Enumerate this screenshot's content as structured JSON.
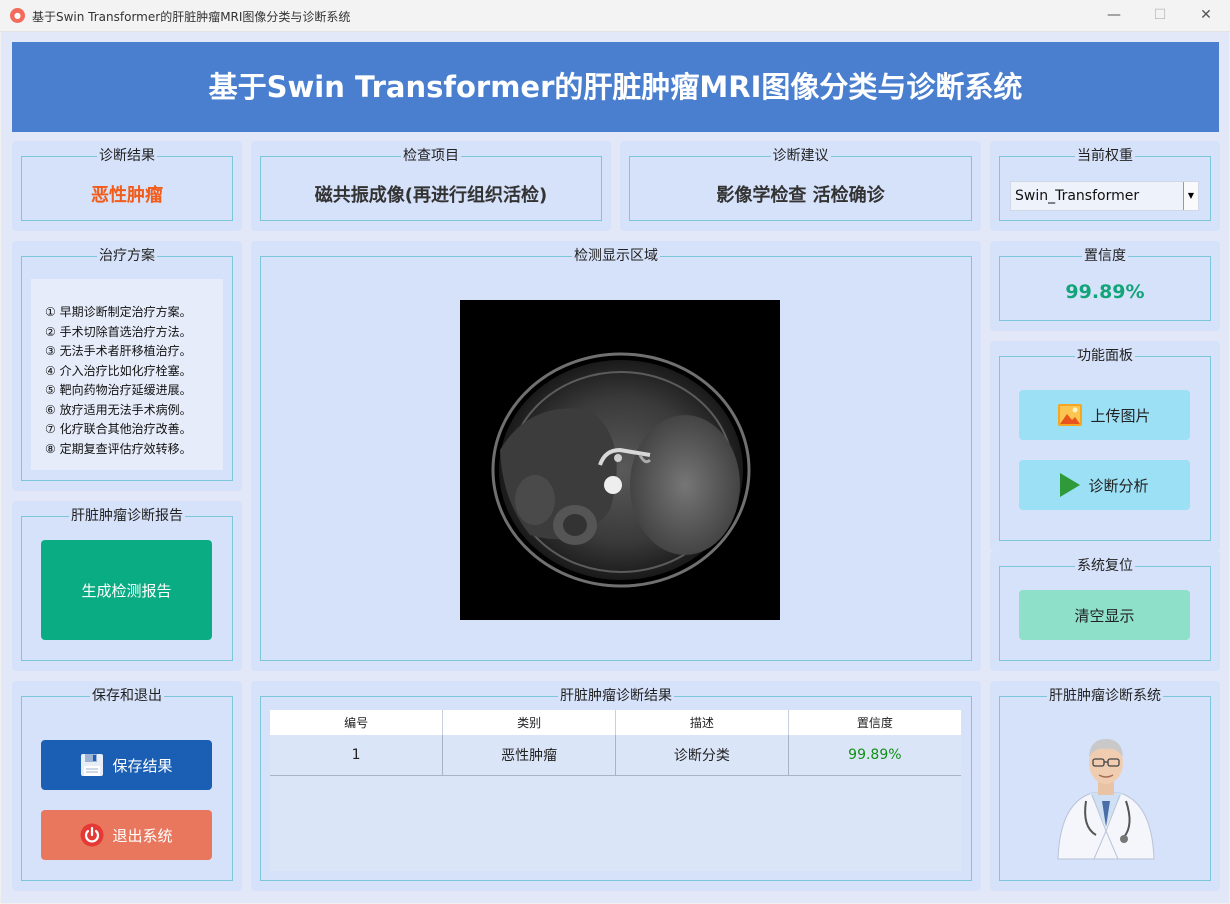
{
  "window": {
    "title": "基于Swin Transformer的肝脏肿瘤MRI图像分类与诊断系统",
    "icon_name": "app-logo-icon",
    "controls": [
      "minimize-icon",
      "maximize-icon",
      "close-icon"
    ]
  },
  "header": {
    "title": "基于Swin Transformer的肝脏肿瘤MRI图像分类与诊断系统"
  },
  "diagnosis_result": {
    "label": "诊断结果",
    "value": "恶性肿瘤",
    "color": "#f25c1a"
  },
  "exam_item": {
    "label": "检查项目",
    "value": "磁共振成像(再进行组织活检)"
  },
  "diagnosis_advice": {
    "label": "诊断建议",
    "value": "影像学检查 活检确诊"
  },
  "weights": {
    "label": "当前权重",
    "selected": "Swin_Transformer"
  },
  "treatment": {
    "label": "治疗方案",
    "items": [
      "① 早期诊断制定治疗方案。",
      "② 手术切除首选治疗方法。",
      "③ 无法手术者肝移植治疗。",
      "④ 介入治疗比如化疗栓塞。",
      "⑤ 靶向药物治疗延缓进展。",
      "⑥ 放疗适用无法手术病例。",
      "⑦ 化疗联合其他治疗改善。",
      "⑧ 定期复查评估疗效转移。"
    ]
  },
  "detection_area": {
    "label": "检测显示区域"
  },
  "confidence": {
    "label": "置信度",
    "value": "99.89%",
    "color": "#13a57a"
  },
  "function_panel": {
    "label": "功能面板",
    "upload_label": "上传图片",
    "upload_icon": "image-icon",
    "analyze_label": "诊断分析",
    "analyze_icon": "play-icon"
  },
  "report": {
    "label": "肝脏肿瘤诊断报告",
    "button_label": "生成检测报告"
  },
  "reset": {
    "label": "系统复位",
    "button_label": "清空显示"
  },
  "save_exit": {
    "label": "保存和退出",
    "save_label": "保存结果",
    "save_icon": "floppy-disk-icon",
    "exit_label": "退出系统",
    "exit_icon": "power-icon"
  },
  "results_table": {
    "label": "肝脏肿瘤诊断结果",
    "columns": [
      "编号",
      "类别",
      "描述",
      "置信度"
    ],
    "rows": [
      {
        "id": "1",
        "category": "恶性肿瘤",
        "description": "诊断分类",
        "confidence": "99.89%"
      }
    ]
  },
  "system_card": {
    "label": "肝脏肿瘤诊断系统",
    "illustration": "doctor-illustration"
  },
  "colors": {
    "header_bg": "#4a7fd0",
    "card_bg": "#d6e2fa",
    "report_button": "#0aad83",
    "save_button": "#1a5fb4",
    "exit_button": "#e8775d",
    "panel_button": "#9ce0f5",
    "clear_button": "#8ee0c9"
  }
}
